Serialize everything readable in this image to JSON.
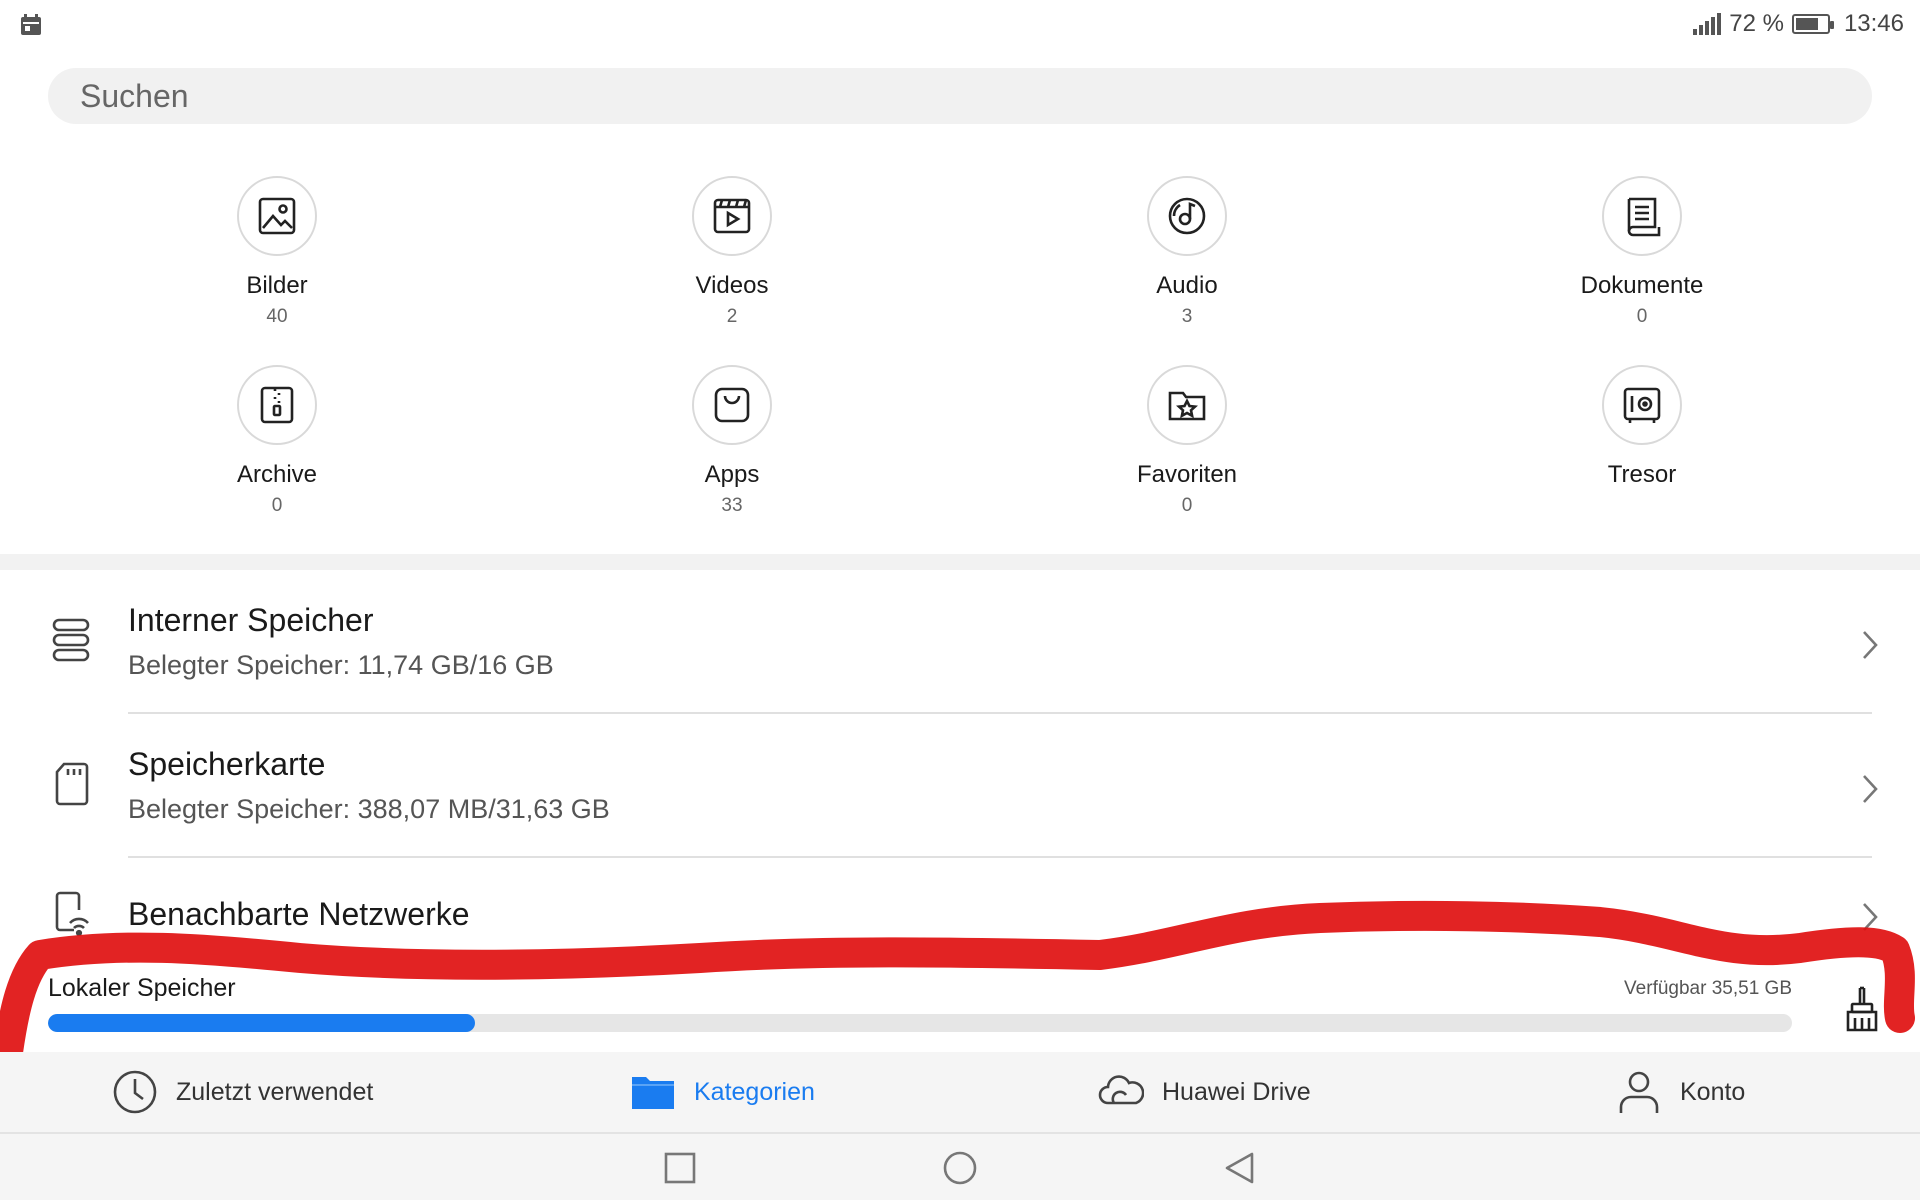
{
  "status_bar": {
    "battery_percent_text": "72 %",
    "battery_level": 0.72,
    "time": "13:46",
    "calendar_icon": "calendar-icon",
    "signal_icon": "signal-icon",
    "battery_icon": "battery-icon"
  },
  "search": {
    "placeholder": "Suchen"
  },
  "categories": [
    {
      "label": "Bilder",
      "count": "40",
      "icon": "image-icon"
    },
    {
      "label": "Videos",
      "count": "2",
      "icon": "video-icon"
    },
    {
      "label": "Audio",
      "count": "3",
      "icon": "music-disc-icon"
    },
    {
      "label": "Dokumente",
      "count": "0",
      "icon": "document-icon"
    },
    {
      "label": "Archive",
      "count": "0",
      "icon": "archive-icon"
    },
    {
      "label": "Apps",
      "count": "33",
      "icon": "shopping-bag-icon"
    },
    {
      "label": "Favoriten",
      "count": "0",
      "icon": "star-folder-icon"
    },
    {
      "label": "Tresor",
      "count": "",
      "icon": "safe-icon"
    }
  ],
  "storage_list": [
    {
      "title": "Interner Speicher",
      "subtitle": "Belegter Speicher: 11,74 GB/16 GB",
      "icon": "storage-stack-icon"
    },
    {
      "title": "Speicherkarte",
      "subtitle": "Belegter Speicher: 388,07 MB/31,63 GB",
      "icon": "sd-card-icon"
    },
    {
      "title": "Benachbarte Netzwerke",
      "subtitle": "",
      "icon": "phone-wifi-icon"
    }
  ],
  "local_storage": {
    "label": "Lokaler Speicher",
    "available": "Verfügbar 35,51 GB",
    "used_fraction": 0.245,
    "bar_color": "#1a7cf0",
    "cleanup_icon": "broom-icon"
  },
  "tabs": [
    {
      "label": "Zuletzt verwendet",
      "icon": "clock-icon",
      "active": false
    },
    {
      "label": "Kategorien",
      "icon": "folder-icon",
      "active": true
    },
    {
      "label": "Huawei Drive",
      "icon": "cloud-icon",
      "active": false
    },
    {
      "label": "Konto",
      "icon": "person-icon",
      "active": false
    }
  ],
  "nav": {
    "recent_icon": "square-icon",
    "home_icon": "circle-icon",
    "back_icon": "triangle-back-icon"
  },
  "colors": {
    "accent": "#1a7cf0",
    "annotation": "#e01010"
  }
}
